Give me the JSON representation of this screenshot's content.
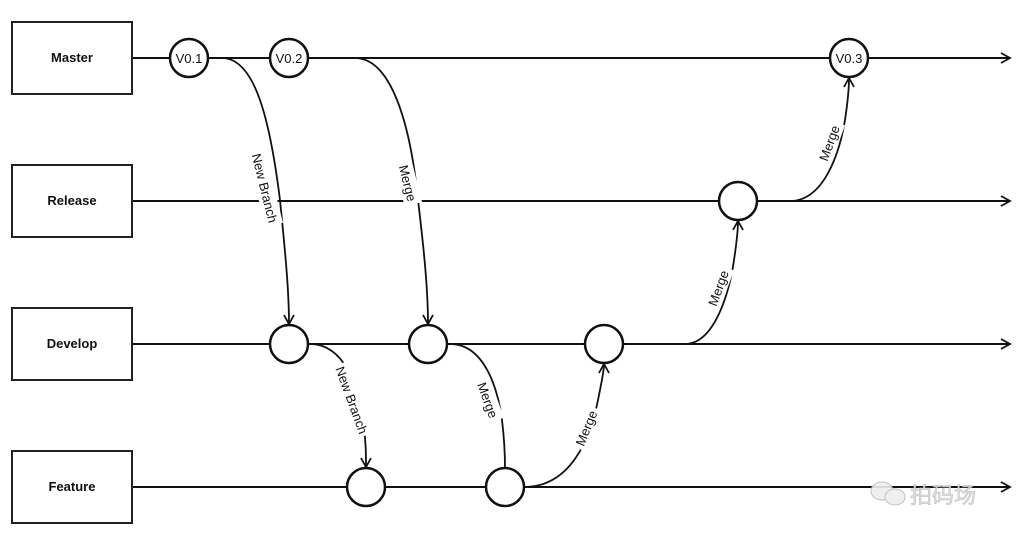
{
  "branches": [
    "Master",
    "Release",
    "Develop",
    "Feature"
  ],
  "versions": [
    "V0.1",
    "V0.2",
    "V0.3"
  ],
  "edge_labels": {
    "master_to_develop_1": "New Branch",
    "master_to_develop_2": "Merge",
    "develop_to_feature_1": "New Branch",
    "feature_to_develop_1": "Merge",
    "feature_to_develop_2": "Merge",
    "develop_to_release": "Merge",
    "release_to_master": "Merge"
  },
  "watermark": "拍码场"
}
